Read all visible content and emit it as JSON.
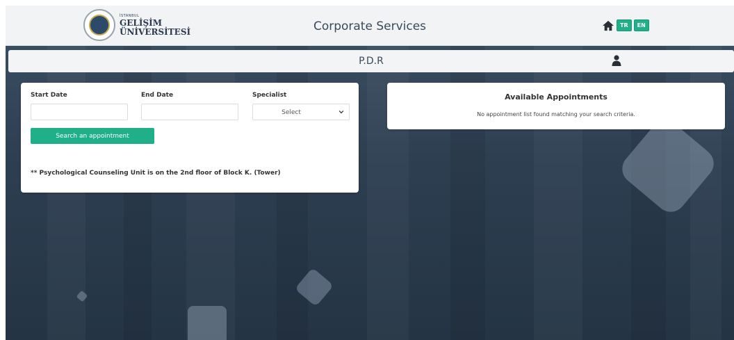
{
  "header": {
    "logo": {
      "line1": "İSTANBUL",
      "line2": "GELİŞİM",
      "line3": "ÜNİVERSİTESİ"
    },
    "title": "Corporate Services",
    "icons": {
      "home": "home-icon"
    },
    "lang": {
      "tr": "TR",
      "en": "EN"
    },
    "accent_color": "#1fb089"
  },
  "subbar": {
    "title": "P.D.R",
    "icon": "user-icon"
  },
  "search": {
    "start_date_label": "Start Date",
    "start_date_value": "",
    "end_date_label": "End Date",
    "end_date_value": "",
    "specialist_label": "Specialist",
    "specialist_selected": "Select",
    "button_label": "Search an appointment",
    "note": "** Psychological Counseling Unit is on the 2nd floor of Block K. (Tower)"
  },
  "appointments": {
    "title": "Available Appointments",
    "message": "No appointment list found matching your search criteria."
  }
}
